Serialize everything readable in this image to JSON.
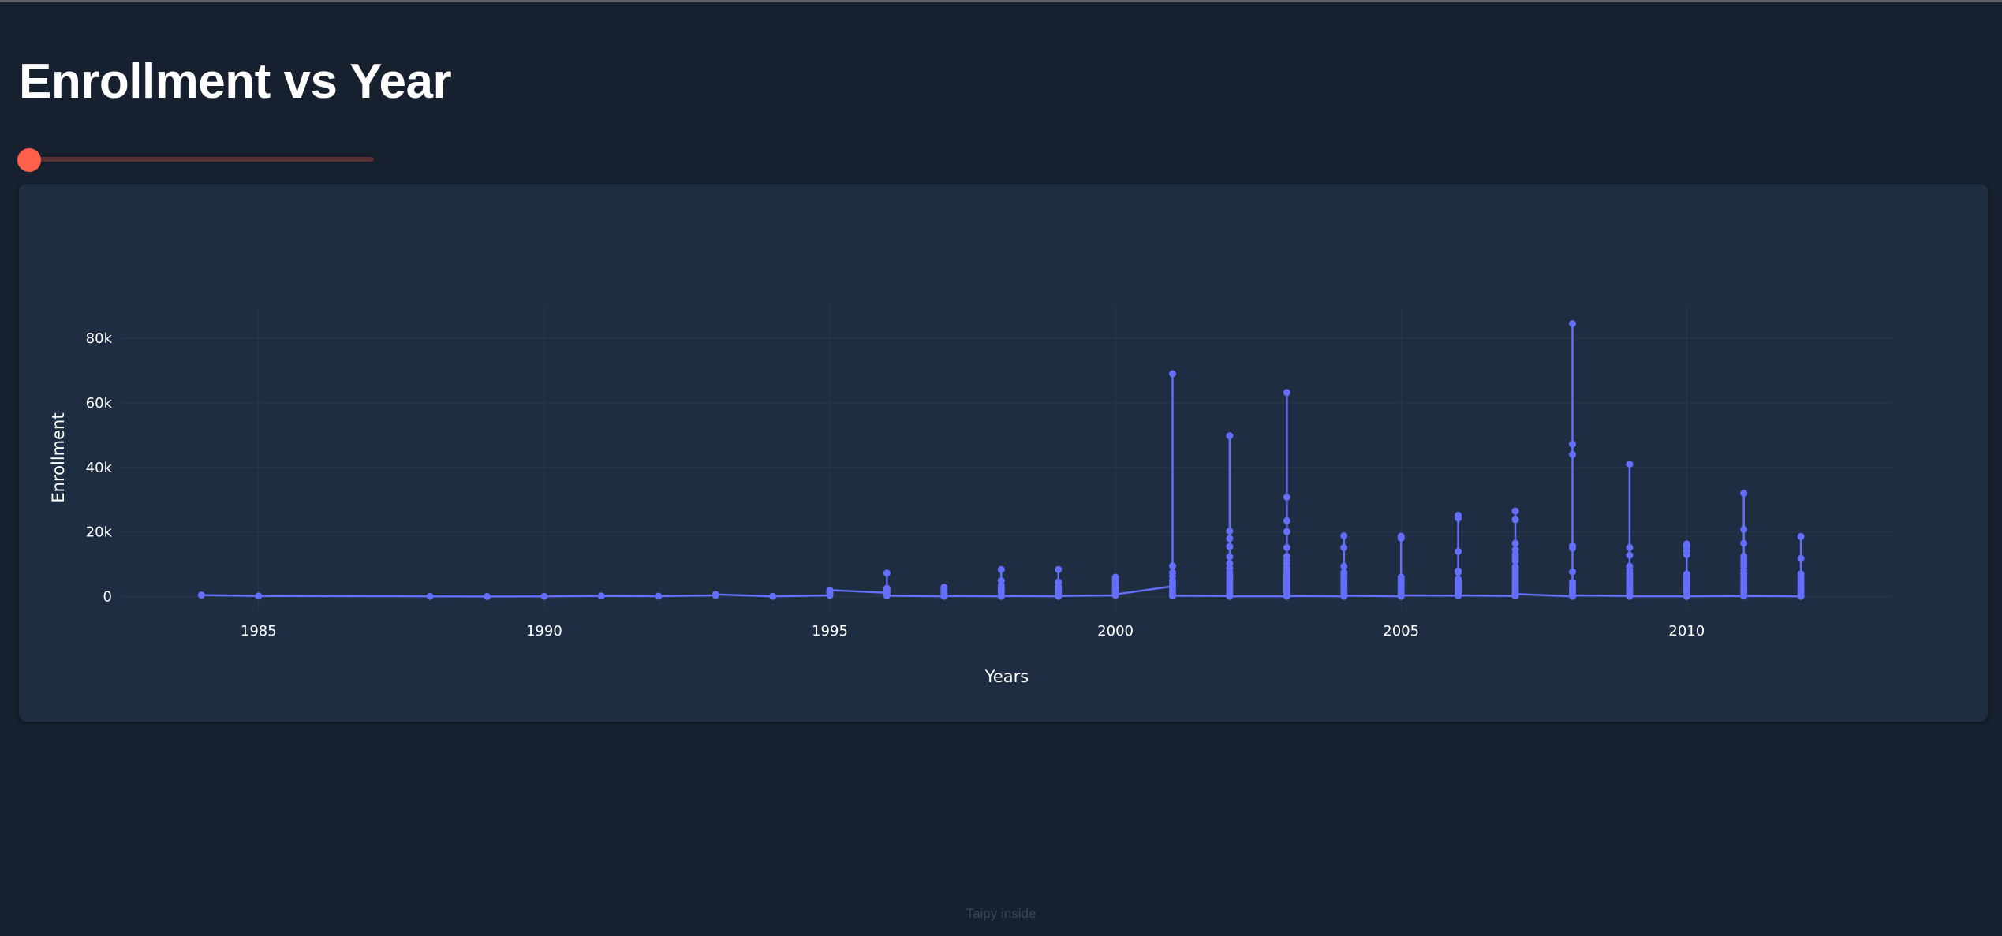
{
  "page": {
    "title": "Enrollment vs Year",
    "footer": "Taipy inside"
  },
  "slider": {
    "value": 0,
    "min": 0,
    "max": 100
  },
  "colors": {
    "background": "#17202f",
    "panel": "#1f2d43",
    "series": "#636efa",
    "slider_thumb": "#ff6049",
    "slider_track": "#5b3035"
  },
  "chart_data": {
    "type": "line",
    "title": "",
    "xlabel": "Years",
    "ylabel": "Enrollment",
    "xlim": [
      1982.6,
      2013.6
    ],
    "ylim": [
      -4000,
      90000
    ],
    "xticks": [
      1985,
      1990,
      1995,
      2000,
      2005,
      2010
    ],
    "xtick_labels": [
      "1985",
      "1990",
      "1995",
      "2000",
      "2005",
      "2010"
    ],
    "yticks": [
      0,
      20000,
      40000,
      60000,
      80000
    ],
    "ytick_labels": [
      "0",
      "20k",
      "40k",
      "60k",
      "80k"
    ],
    "grid": true,
    "legend": false,
    "series": [
      {
        "markers": true,
        "points": [
          [
            1984,
            500
          ],
          [
            1985,
            200
          ],
          [
            1988,
            100
          ],
          [
            1989,
            50
          ],
          [
            1990,
            100
          ],
          [
            1991,
            200
          ],
          [
            1992,
            150
          ],
          [
            1993,
            400
          ],
          [
            1993,
            700
          ],
          [
            1994,
            100
          ],
          [
            1995,
            400
          ],
          [
            1995,
            1000
          ],
          [
            1995,
            1500
          ],
          [
            1995,
            2000
          ],
          [
            1996,
            1200
          ],
          [
            1996,
            500
          ],
          [
            1996,
            1800
          ],
          [
            1996,
            2600
          ],
          [
            1996,
            7300
          ],
          [
            1996,
            300
          ],
          [
            1997,
            100
          ],
          [
            1997,
            800
          ],
          [
            1997,
            1500
          ],
          [
            1997,
            2200
          ],
          [
            1997,
            2900
          ],
          [
            1997,
            200
          ],
          [
            1998,
            100
          ],
          [
            1998,
            700
          ],
          [
            1998,
            1400
          ],
          [
            1998,
            2100
          ],
          [
            1998,
            2800
          ],
          [
            1998,
            3500
          ],
          [
            1998,
            4900
          ],
          [
            1998,
            8400
          ],
          [
            1998,
            200
          ],
          [
            1999,
            100
          ],
          [
            1999,
            800
          ],
          [
            1999,
            1600
          ],
          [
            1999,
            2300
          ],
          [
            1999,
            3100
          ],
          [
            1999,
            4500
          ],
          [
            1999,
            8400
          ],
          [
            1999,
            200
          ],
          [
            2000,
            400
          ],
          [
            2000,
            1100
          ],
          [
            2000,
            1800
          ],
          [
            2000,
            2600
          ],
          [
            2000,
            3400
          ],
          [
            2000,
            4300
          ],
          [
            2000,
            5200
          ],
          [
            2000,
            6000
          ],
          [
            2000,
            700
          ],
          [
            2001,
            3200
          ],
          [
            2001,
            200
          ],
          [
            2001,
            1000
          ],
          [
            2001,
            1700
          ],
          [
            2001,
            2500
          ],
          [
            2001,
            3300
          ],
          [
            2001,
            4100
          ],
          [
            2001,
            5000
          ],
          [
            2001,
            6200
          ],
          [
            2001,
            7500
          ],
          [
            2001,
            9500
          ],
          [
            2001,
            69000
          ],
          [
            2001,
            300
          ],
          [
            2002,
            200
          ],
          [
            2002,
            900
          ],
          [
            2002,
            1600
          ],
          [
            2002,
            2400
          ],
          [
            2002,
            3200
          ],
          [
            2002,
            4000
          ],
          [
            2002,
            4800
          ],
          [
            2002,
            5600
          ],
          [
            2002,
            6500
          ],
          [
            2002,
            7500
          ],
          [
            2002,
            8700
          ],
          [
            2002,
            10200
          ],
          [
            2002,
            12300
          ],
          [
            2002,
            15500
          ],
          [
            2002,
            18000
          ],
          [
            2002,
            20300
          ],
          [
            2002,
            49800
          ],
          [
            2002,
            100
          ],
          [
            2003,
            100
          ],
          [
            2003,
            800
          ],
          [
            2003,
            1500
          ],
          [
            2003,
            2200
          ],
          [
            2003,
            3000
          ],
          [
            2003,
            3800
          ],
          [
            2003,
            4600
          ],
          [
            2003,
            5400
          ],
          [
            2003,
            6200
          ],
          [
            2003,
            7100
          ],
          [
            2003,
            8000
          ],
          [
            2003,
            9000
          ],
          [
            2003,
            10100
          ],
          [
            2003,
            11200
          ],
          [
            2003,
            12400
          ],
          [
            2003,
            15200
          ],
          [
            2003,
            20100
          ],
          [
            2003,
            23500
          ],
          [
            2003,
            30800
          ],
          [
            2003,
            63200
          ],
          [
            2003,
            200
          ],
          [
            2004,
            100
          ],
          [
            2004,
            700
          ],
          [
            2004,
            1400
          ],
          [
            2004,
            2100
          ],
          [
            2004,
            2800
          ],
          [
            2004,
            3500
          ],
          [
            2004,
            4200
          ],
          [
            2004,
            5000
          ],
          [
            2004,
            5800
          ],
          [
            2004,
            6700
          ],
          [
            2004,
            7600
          ],
          [
            2004,
            9400
          ],
          [
            2004,
            15200
          ],
          [
            2004,
            18800
          ],
          [
            2004,
            300
          ],
          [
            2005,
            100
          ],
          [
            2005,
            800
          ],
          [
            2005,
            1500
          ],
          [
            2005,
            2200
          ],
          [
            2005,
            2900
          ],
          [
            2005,
            3600
          ],
          [
            2005,
            4300
          ],
          [
            2005,
            5100
          ],
          [
            2005,
            6000
          ],
          [
            2005,
            18100
          ],
          [
            2005,
            18700
          ],
          [
            2005,
            400
          ],
          [
            2006,
            300
          ],
          [
            2006,
            1000
          ],
          [
            2006,
            1700
          ],
          [
            2006,
            2400
          ],
          [
            2006,
            3100
          ],
          [
            2006,
            3800
          ],
          [
            2006,
            4600
          ],
          [
            2006,
            5400
          ],
          [
            2006,
            7500
          ],
          [
            2006,
            8000
          ],
          [
            2006,
            14000
          ],
          [
            2006,
            24300
          ],
          [
            2006,
            25200
          ],
          [
            2006,
            400
          ],
          [
            2007,
            200
          ],
          [
            2007,
            900
          ],
          [
            2007,
            1600
          ],
          [
            2007,
            2300
          ],
          [
            2007,
            3000
          ],
          [
            2007,
            3800
          ],
          [
            2007,
            4600
          ],
          [
            2007,
            5400
          ],
          [
            2007,
            6300
          ],
          [
            2007,
            7200
          ],
          [
            2007,
            8200
          ],
          [
            2007,
            9200
          ],
          [
            2007,
            11000
          ],
          [
            2007,
            12000
          ],
          [
            2007,
            13000
          ],
          [
            2007,
            14500
          ],
          [
            2007,
            16500
          ],
          [
            2007,
            23800
          ],
          [
            2007,
            26500
          ],
          [
            2007,
            800
          ],
          [
            2008,
            100
          ],
          [
            2008,
            800
          ],
          [
            2008,
            1500
          ],
          [
            2008,
            2200
          ],
          [
            2008,
            2900
          ],
          [
            2008,
            3600
          ],
          [
            2008,
            4400
          ],
          [
            2008,
            7700
          ],
          [
            2008,
            15000
          ],
          [
            2008,
            15800
          ],
          [
            2008,
            44000
          ],
          [
            2008,
            47200
          ],
          [
            2008,
            84500
          ],
          [
            2008,
            400
          ],
          [
            2009,
            200
          ],
          [
            2009,
            900
          ],
          [
            2009,
            1600
          ],
          [
            2009,
            2300
          ],
          [
            2009,
            3000
          ],
          [
            2009,
            3800
          ],
          [
            2009,
            4600
          ],
          [
            2009,
            5400
          ],
          [
            2009,
            6300
          ],
          [
            2009,
            7200
          ],
          [
            2009,
            8200
          ],
          [
            2009,
            9400
          ],
          [
            2009,
            12800
          ],
          [
            2009,
            15200
          ],
          [
            2009,
            41000
          ],
          [
            2009,
            100
          ],
          [
            2010,
            100
          ],
          [
            2010,
            800
          ],
          [
            2010,
            1500
          ],
          [
            2010,
            2200
          ],
          [
            2010,
            2900
          ],
          [
            2010,
            3600
          ],
          [
            2010,
            4400
          ],
          [
            2010,
            5200
          ],
          [
            2010,
            6000
          ],
          [
            2010,
            7000
          ],
          [
            2010,
            13000
          ],
          [
            2010,
            14200
          ],
          [
            2010,
            15500
          ],
          [
            2010,
            16300
          ],
          [
            2010,
            100
          ],
          [
            2011,
            200
          ],
          [
            2011,
            900
          ],
          [
            2011,
            1600
          ],
          [
            2011,
            2300
          ],
          [
            2011,
            3000
          ],
          [
            2011,
            3800
          ],
          [
            2011,
            4600
          ],
          [
            2011,
            5400
          ],
          [
            2011,
            6300
          ],
          [
            2011,
            7200
          ],
          [
            2011,
            8200
          ],
          [
            2011,
            9400
          ],
          [
            2011,
            10500
          ],
          [
            2011,
            11500
          ],
          [
            2011,
            12500
          ],
          [
            2011,
            16500
          ],
          [
            2011,
            20800
          ],
          [
            2011,
            32000
          ],
          [
            2011,
            200
          ],
          [
            2012,
            100
          ],
          [
            2012,
            700
          ],
          [
            2012,
            1400
          ],
          [
            2012,
            2100
          ],
          [
            2012,
            2800
          ],
          [
            2012,
            3500
          ],
          [
            2012,
            4300
          ],
          [
            2012,
            5100
          ],
          [
            2012,
            6000
          ],
          [
            2012,
            7000
          ],
          [
            2012,
            11800
          ],
          [
            2012,
            18600
          ],
          [
            2012,
            200
          ]
        ]
      }
    ]
  }
}
